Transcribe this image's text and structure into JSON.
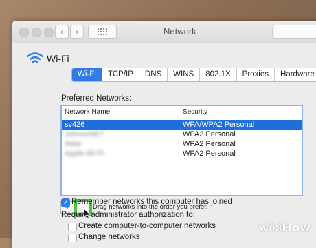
{
  "window": {
    "title": "Network",
    "service_name": "Wi-Fi"
  },
  "tabs": [
    {
      "label": "Wi-Fi",
      "active": true
    },
    {
      "label": "TCP/IP",
      "active": false
    },
    {
      "label": "DNS",
      "active": false
    },
    {
      "label": "WINS",
      "active": false
    },
    {
      "label": "802.1X",
      "active": false
    },
    {
      "label": "Proxies",
      "active": false
    },
    {
      "label": "Hardware",
      "active": false
    }
  ],
  "preferred": {
    "label": "Preferred Networks:",
    "headers": {
      "name": "Network Name",
      "security": "Security"
    },
    "rows": [
      {
        "name": "sv426",
        "security": "WPA/WPA2 Personal",
        "selected": true,
        "blurred": false
      },
      {
        "name": "JohnsoNET",
        "security": "WPA2 Personal",
        "selected": false,
        "blurred": true
      },
      {
        "name": "Atlas",
        "security": "WPA2 Personal",
        "selected": false,
        "blurred": true
      },
      {
        "name": "Apple-Wi-Fi",
        "security": "WPA2 Personal",
        "selected": false,
        "blurred": true
      }
    ]
  },
  "controls": {
    "plus_label": "+",
    "minus_label": "−",
    "drag_hint": "Drag networks into the order you prefer."
  },
  "options": {
    "remember_label": "Remember networks this computer has joined",
    "remember_checked": true,
    "require_label": "Require administrator authorization to:",
    "create_label": "Create computer-to-computer networks",
    "change_label": "Change networks"
  },
  "watermark": {
    "wiki": "wiki",
    "how": "How"
  },
  "colors": {
    "accent": "#2f7ce6",
    "highlight": "#47c83a",
    "selection": "#1e6fd9"
  }
}
